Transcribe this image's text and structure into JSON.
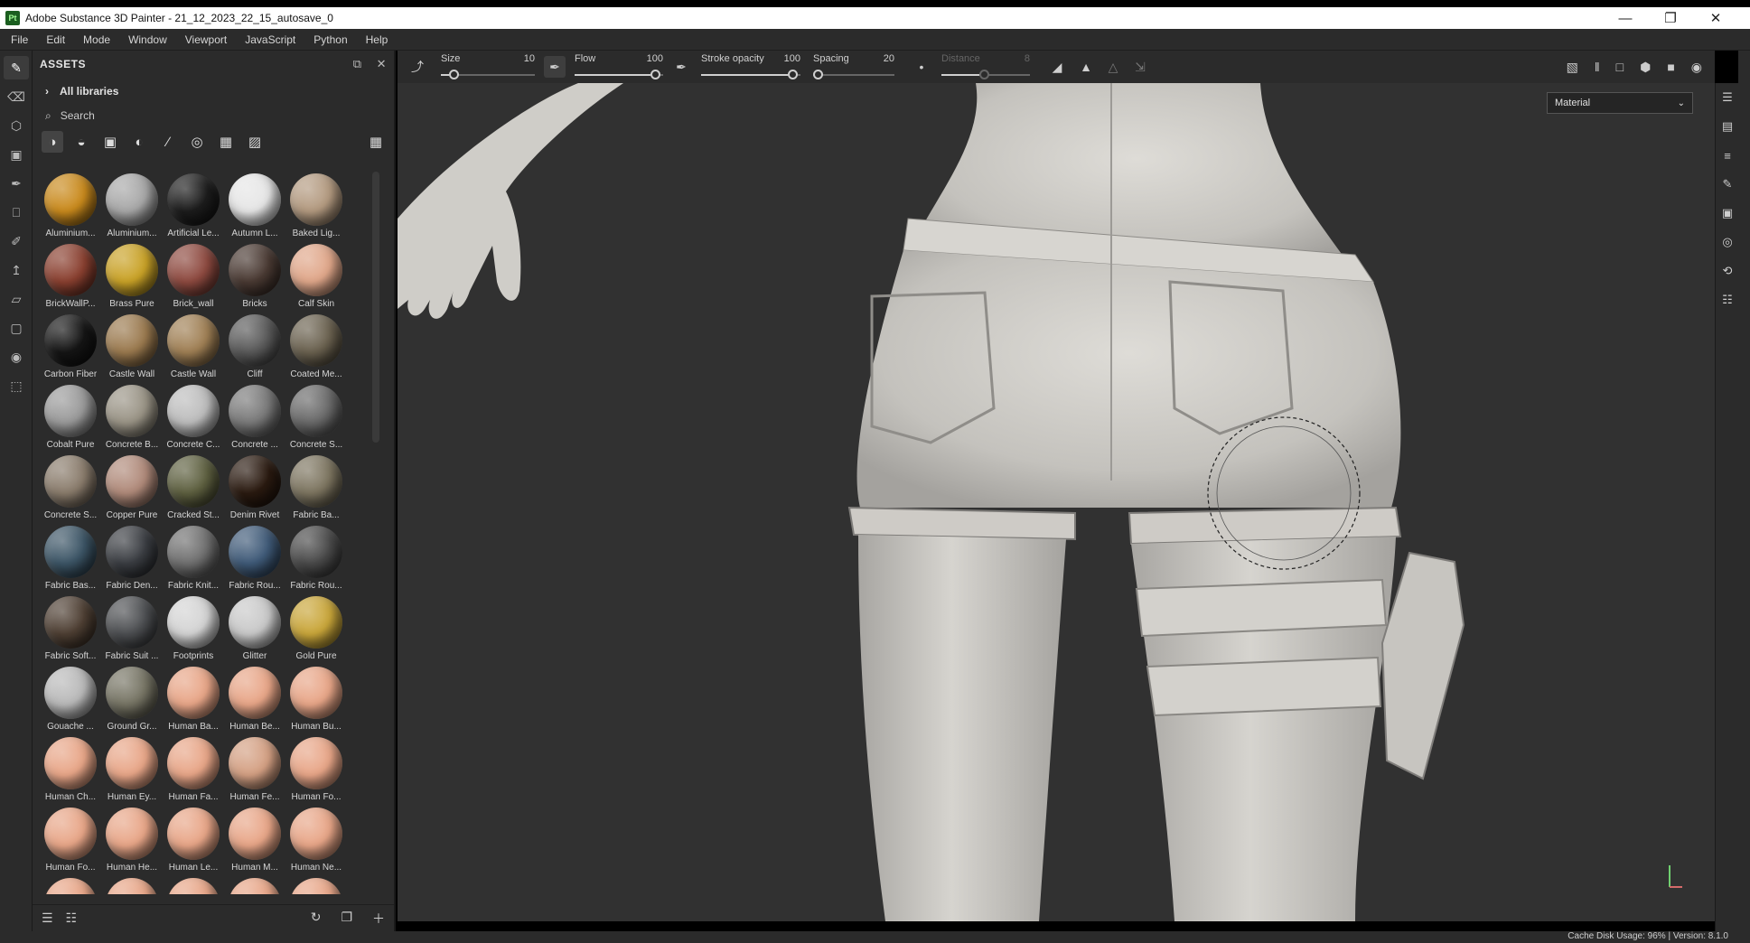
{
  "window": {
    "title": "Adobe Substance 3D Painter - 21_12_2023_22_15_autosave_0",
    "logo_text": "Pt"
  },
  "menu": [
    "File",
    "Edit",
    "Mode",
    "Window",
    "Viewport",
    "JavaScript",
    "Python",
    "Help"
  ],
  "assets_panel": {
    "title": "ASSETS",
    "library": "All libraries",
    "search_placeholder": "Search",
    "items": [
      {
        "label": "Aluminium...",
        "color": "#c98a1d"
      },
      {
        "label": "Aluminium...",
        "color": "#a8a8a8"
      },
      {
        "label": "Artificial Le...",
        "color": "#1c1c1c"
      },
      {
        "label": "Autumn L...",
        "color": "#e6e6e6"
      },
      {
        "label": "Baked Lig...",
        "color": "#b39a80"
      },
      {
        "label": "BrickWallP...",
        "color": "#8a4030"
      },
      {
        "label": "Brass Pure",
        "color": "#c9a227"
      },
      {
        "label": "Brick_wall",
        "color": "#8e4a40"
      },
      {
        "label": "Bricks",
        "color": "#4a3a33"
      },
      {
        "label": "Calf Skin",
        "color": "#e0a78a"
      },
      {
        "label": "Carbon Fiber",
        "color": "#151515"
      },
      {
        "label": "Castle Wall",
        "color": "#9b7a4f"
      },
      {
        "label": "Castle Wall",
        "color": "#a08055"
      },
      {
        "label": "Cliff",
        "color": "#5a5a5a"
      },
      {
        "label": "Coated Me...",
        "color": "#6b6250"
      },
      {
        "label": "Cobalt Pure",
        "color": "#9a9a9a"
      },
      {
        "label": "Concrete B...",
        "color": "#9a9486"
      },
      {
        "label": "Concrete C...",
        "color": "#bdbdbd"
      },
      {
        "label": "Concrete ...",
        "color": "#7a7a7a"
      },
      {
        "label": "Concrete S...",
        "color": "#6a6a6a"
      },
      {
        "label": "Concrete S...",
        "color": "#8a7c6c"
      },
      {
        "label": "Copper Pure",
        "color": "#b08a7a"
      },
      {
        "label": "Cracked St...",
        "color": "#5e6040"
      },
      {
        "label": "Denim Rivet",
        "color": "#2a1a10"
      },
      {
        "label": "Fabric Ba...",
        "color": "#7d7560"
      },
      {
        "label": "Fabric Bas...",
        "color": "#3c5566"
      },
      {
        "label": "Fabric Den...",
        "color": "#3a3d42"
      },
      {
        "label": "Fabric Knit...",
        "color": "#707070"
      },
      {
        "label": "Fabric Rou...",
        "color": "#3f5a78"
      },
      {
        "label": "Fabric Rou...",
        "color": "#4a4a4a"
      },
      {
        "label": "Fabric Soft...",
        "color": "#4e3f33"
      },
      {
        "label": "Fabric Suit ...",
        "color": "#4d4f52"
      },
      {
        "label": "Footprints",
        "color": "#d4d4d4"
      },
      {
        "label": "Glitter",
        "color": "#c9c9c9"
      },
      {
        "label": "Gold Pure",
        "color": "#c9a63a"
      },
      {
        "label": "Gouache ...",
        "color": "#b9b9b9"
      },
      {
        "label": "Ground Gr...",
        "color": "#767464"
      },
      {
        "label": "Human Ba...",
        "color": "#e8a688"
      },
      {
        "label": "Human Be...",
        "color": "#e8a688"
      },
      {
        "label": "Human Bu...",
        "color": "#e8a688"
      },
      {
        "label": "Human Ch...",
        "color": "#e8a688"
      },
      {
        "label": "Human Ey...",
        "color": "#e8a688"
      },
      {
        "label": "Human Fa...",
        "color": "#e8a688"
      },
      {
        "label": "Human Fe...",
        "color": "#d4a083"
      },
      {
        "label": "Human Fo...",
        "color": "#e8a688"
      },
      {
        "label": "Human Fo...",
        "color": "#e8a688"
      },
      {
        "label": "Human He...",
        "color": "#e8a688"
      },
      {
        "label": "Human Le...",
        "color": "#e8a688"
      },
      {
        "label": "Human M...",
        "color": "#e8a688"
      },
      {
        "label": "Human Ne...",
        "color": "#e8a688"
      },
      {
        "label": "",
        "color": "#e8a688"
      },
      {
        "label": "",
        "color": "#e8a688"
      },
      {
        "label": "",
        "color": "#e8a688"
      },
      {
        "label": "",
        "color": "#e8a688"
      },
      {
        "label": "",
        "color": "#e8a688"
      }
    ]
  },
  "toolbar": {
    "size": {
      "label": "Size",
      "value": "10",
      "level": 0.1
    },
    "flow": {
      "label": "Flow",
      "value": "100",
      "level": 1.0
    },
    "stroke_opacity": {
      "label": "Stroke opacity",
      "value": "100",
      "level": 1.0
    },
    "spacing": {
      "label": "Spacing",
      "value": "20",
      "level": 0.0
    },
    "distance": {
      "label": "Distance",
      "value": "8",
      "level": 0.5
    }
  },
  "viewport": {
    "mode": "Material"
  },
  "status": {
    "text": "Cache Disk Usage:   96% | Version: 8.1.0"
  },
  "colors": {
    "panel_bg": "#2b2b2b",
    "viewport_bg": "#313131",
    "model": "#cfcdc8"
  }
}
